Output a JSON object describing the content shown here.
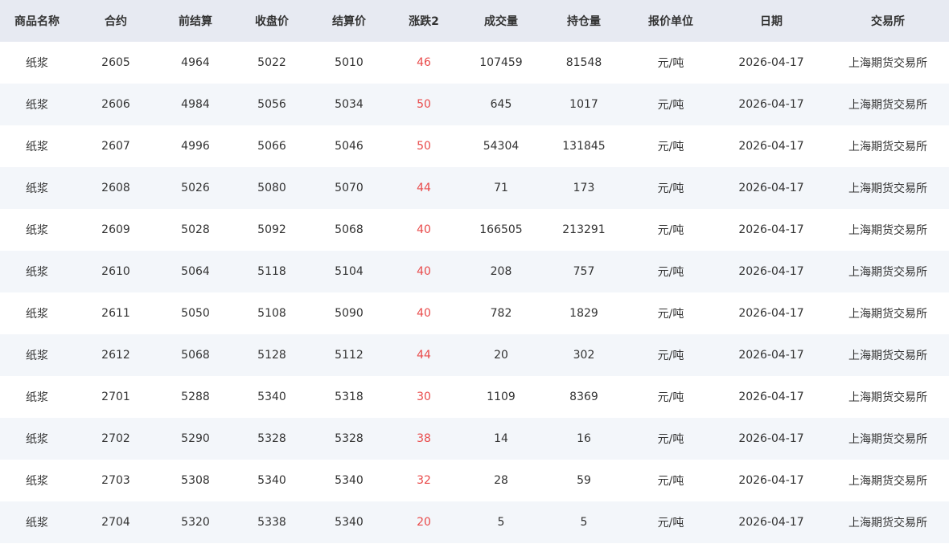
{
  "table": {
    "headers": [
      "商品名称",
      "合约",
      "前结算",
      "收盘价",
      "结算价",
      "涨跌2",
      "成交量",
      "持仓量",
      "报价单位",
      "日期",
      "交易所"
    ],
    "rows": [
      [
        "纸浆",
        "2605",
        "4964",
        "5022",
        "5010",
        "46",
        "107459",
        "81548",
        "元/吨",
        "2026-04-17",
        "上海期货交易所"
      ],
      [
        "纸浆",
        "2606",
        "4984",
        "5056",
        "5034",
        "50",
        "645",
        "1017",
        "元/吨",
        "2026-04-17",
        "上海期货交易所"
      ],
      [
        "纸浆",
        "2607",
        "4996",
        "5066",
        "5046",
        "50",
        "54304",
        "131845",
        "元/吨",
        "2026-04-17",
        "上海期货交易所"
      ],
      [
        "纸浆",
        "2608",
        "5026",
        "5080",
        "5070",
        "44",
        "71",
        "173",
        "元/吨",
        "2026-04-17",
        "上海期货交易所"
      ],
      [
        "纸浆",
        "2609",
        "5028",
        "5092",
        "5068",
        "40",
        "166505",
        "213291",
        "元/吨",
        "2026-04-17",
        "上海期货交易所"
      ],
      [
        "纸浆",
        "2610",
        "5064",
        "5118",
        "5104",
        "40",
        "208",
        "757",
        "元/吨",
        "2026-04-17",
        "上海期货交易所"
      ],
      [
        "纸浆",
        "2611",
        "5050",
        "5108",
        "5090",
        "40",
        "782",
        "1829",
        "元/吨",
        "2026-04-17",
        "上海期货交易所"
      ],
      [
        "纸浆",
        "2612",
        "5068",
        "5128",
        "5112",
        "44",
        "20",
        "302",
        "元/吨",
        "2026-04-17",
        "上海期货交易所"
      ],
      [
        "纸浆",
        "2701",
        "5288",
        "5340",
        "5318",
        "30",
        "1109",
        "8369",
        "元/吨",
        "2026-04-17",
        "上海期货交易所"
      ],
      [
        "纸浆",
        "2702",
        "5290",
        "5328",
        "5328",
        "38",
        "14",
        "16",
        "元/吨",
        "2026-04-17",
        "上海期货交易所"
      ],
      [
        "纸浆",
        "2703",
        "5308",
        "5340",
        "5340",
        "32",
        "28",
        "59",
        "元/吨",
        "2026-04-17",
        "上海期货交易所"
      ],
      [
        "纸浆",
        "2704",
        "5320",
        "5338",
        "5340",
        "20",
        "5",
        "5",
        "元/吨",
        "2026-04-17",
        "上海期货交易所"
      ]
    ]
  },
  "colors": {
    "header_bg": "#e7eaf2",
    "stripe_bg": "#f3f6fa",
    "change_up": "#e94a4a"
  }
}
